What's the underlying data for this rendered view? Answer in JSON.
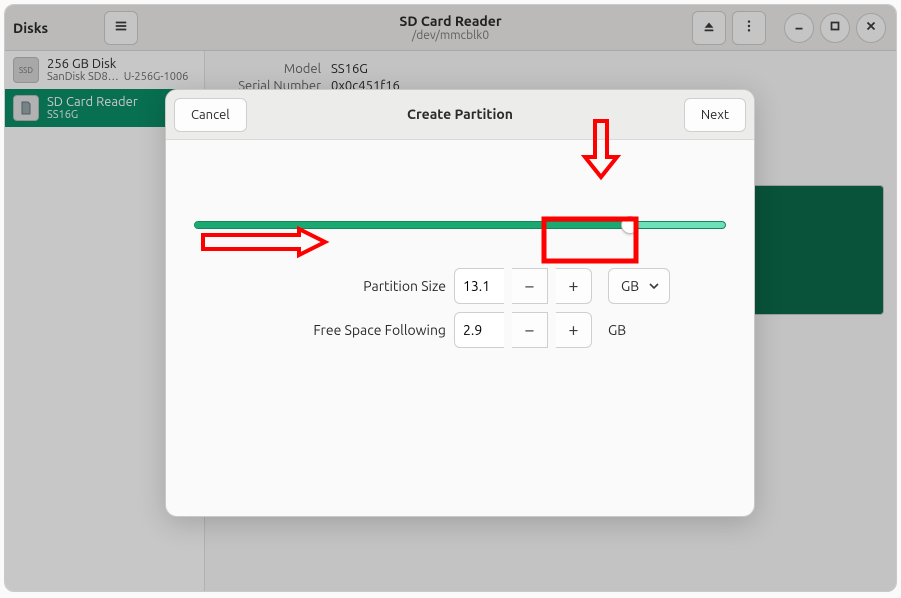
{
  "titlebar": {
    "app_name": "Disks",
    "device_title": "SD Card Reader",
    "device_path": "/dev/mmcblk0"
  },
  "sidebar": {
    "disks": [
      {
        "line1": "256 GB Disk",
        "line2a": "SanDisk SD8…",
        "line2b": "U-256G-1006",
        "icon_label": "SSD"
      },
      {
        "line1": "SD Card Reader",
        "line2": "SS16G",
        "icon_label": ""
      }
    ]
  },
  "details": {
    "model_key": "Model",
    "model_val": "SS16G",
    "serial_key": "Serial Number",
    "serial_val": "0x0c451f16"
  },
  "dialog": {
    "title": "Create Partition",
    "cancel": "Cancel",
    "next": "Next",
    "partition_size_label": "Partition Size",
    "partition_size_value": "13.1",
    "free_space_label": "Free Space Following",
    "free_space_value": "2.9",
    "unit_selected": "GB",
    "unit_static": "GB"
  }
}
